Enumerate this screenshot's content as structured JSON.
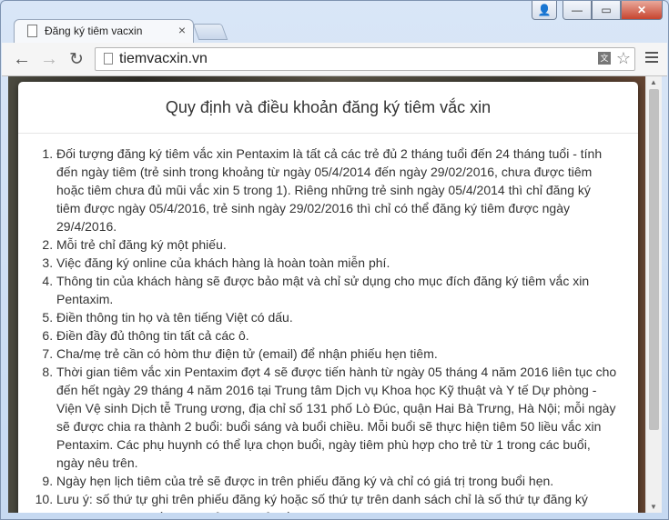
{
  "browser": {
    "tab_title": "Đăng ký tiêm vacxin",
    "url": "tiemvacxin.vn"
  },
  "modal": {
    "title": "Quy định và điều khoản đăng ký tiêm vắc xin",
    "terms": [
      "Đối tượng đăng ký tiêm vắc xin Pentaxim là tất cả các trẻ đủ 2 tháng tuổi đến 24 tháng tuổi - tính đến ngày tiêm (trẻ sinh trong khoảng từ ngày 05/4/2014 đến ngày 29/02/2016, chưa được tiêm hoặc tiêm chưa đủ mũi vắc xin 5 trong 1). Riêng những trẻ sinh ngày 05/4/2014 thì chỉ đăng ký tiêm được ngày 05/4/2016, trẻ sinh ngày 29/02/2016 thì chỉ có thể đăng ký tiêm được ngày 29/4/2016.",
      "Mỗi trẻ chỉ đăng ký một phiếu.",
      "Việc đăng ký online của khách hàng là hoàn toàn miễn phí.",
      "Thông tin của khách hàng sẽ được bảo mật và chỉ sử dụng cho mục đích đăng ký tiêm vắc xin Pentaxim.",
      "Điền thông tin họ và tên tiếng Việt có dấu.",
      "Điền đầy đủ thông tin tất cả các ô.",
      "Cha/mẹ trẻ cần có hòm thư điện tử (email) để nhận phiếu hẹn tiêm.",
      "Thời gian tiêm vắc xin Pentaxim đợt 4 sẽ được tiến hành từ ngày 05 tháng 4 năm 2016 liên tục cho đến hết ngày 29 tháng 4 năm 2016 tại Trung tâm Dịch vụ Khoa học Kỹ thuật và Y tế Dự phòng - Viện Vệ sinh Dịch tễ Trung ương, địa chỉ số 131 phố Lò Đúc, quận Hai Bà Trưng, Hà Nội; mỗi ngày sẽ được chia ra thành 2 buổi: buổi sáng và buổi chiều. Mỗi buổi sẽ thực hiện tiêm 50 liều vắc xin Pentaxim. Các phụ huynh có thể lựa chọn buổi, ngày tiêm phù hợp cho trẻ từ 1 trong các buổi, ngày nêu trên.",
      "Ngày hẹn lịch tiêm của trẻ sẽ được in trên phiếu đăng ký và chỉ có giá trị trong buổi hẹn.",
      "Lưu ý: số thứ tự ghi trên phiếu đăng ký hoặc số thứ tự trên danh sách chỉ là số thứ tự đăng ký thành công. Khi đến tiêm chủng thì trẻ đến trước sẽ được tiêm trước."
    ]
  }
}
